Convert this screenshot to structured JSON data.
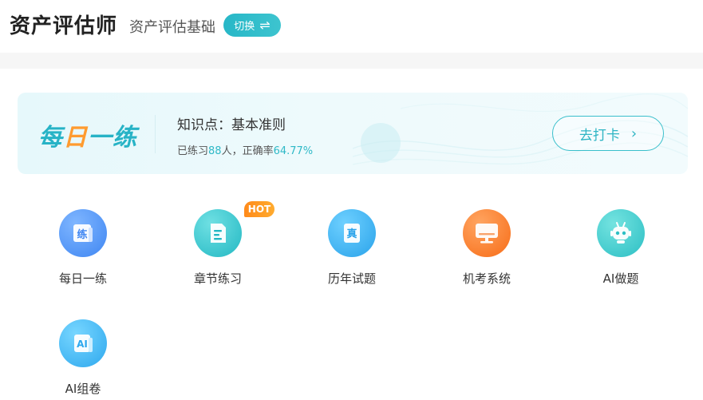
{
  "header": {
    "title": "资产评估师",
    "subtitle": "资产评估基础",
    "switch_label": "切换",
    "switch_icon": "⇌"
  },
  "daily": {
    "logo_part1": "每",
    "logo_part2": "日",
    "logo_part3": "一练",
    "knowledge_label": "知识点：",
    "knowledge_value": "基本准则",
    "stats_prefix": "已练习",
    "practice_count": "88",
    "stats_mid": "人，正确率",
    "accuracy": "64.77%",
    "button_label": "去打卡",
    "button_icon": "›"
  },
  "badge": {
    "hot": "HOT"
  },
  "grid": {
    "items": [
      {
        "label": "每日一练",
        "icon": "practice-icon",
        "glyph": "练"
      },
      {
        "label": "章节练习",
        "icon": "document-icon",
        "glyph": ""
      },
      {
        "label": "历年试题",
        "icon": "exam-paper-icon",
        "glyph": "真"
      },
      {
        "label": "机考系统",
        "icon": "computer-icon",
        "glyph": ""
      },
      {
        "label": "AI做题",
        "icon": "robot-icon",
        "glyph": ""
      },
      {
        "label": "AI组卷",
        "icon": "ai-paper-icon",
        "glyph": "AI"
      }
    ]
  },
  "colors": {
    "accent": "#2fb9c7",
    "hot": "#ff8a1a"
  }
}
